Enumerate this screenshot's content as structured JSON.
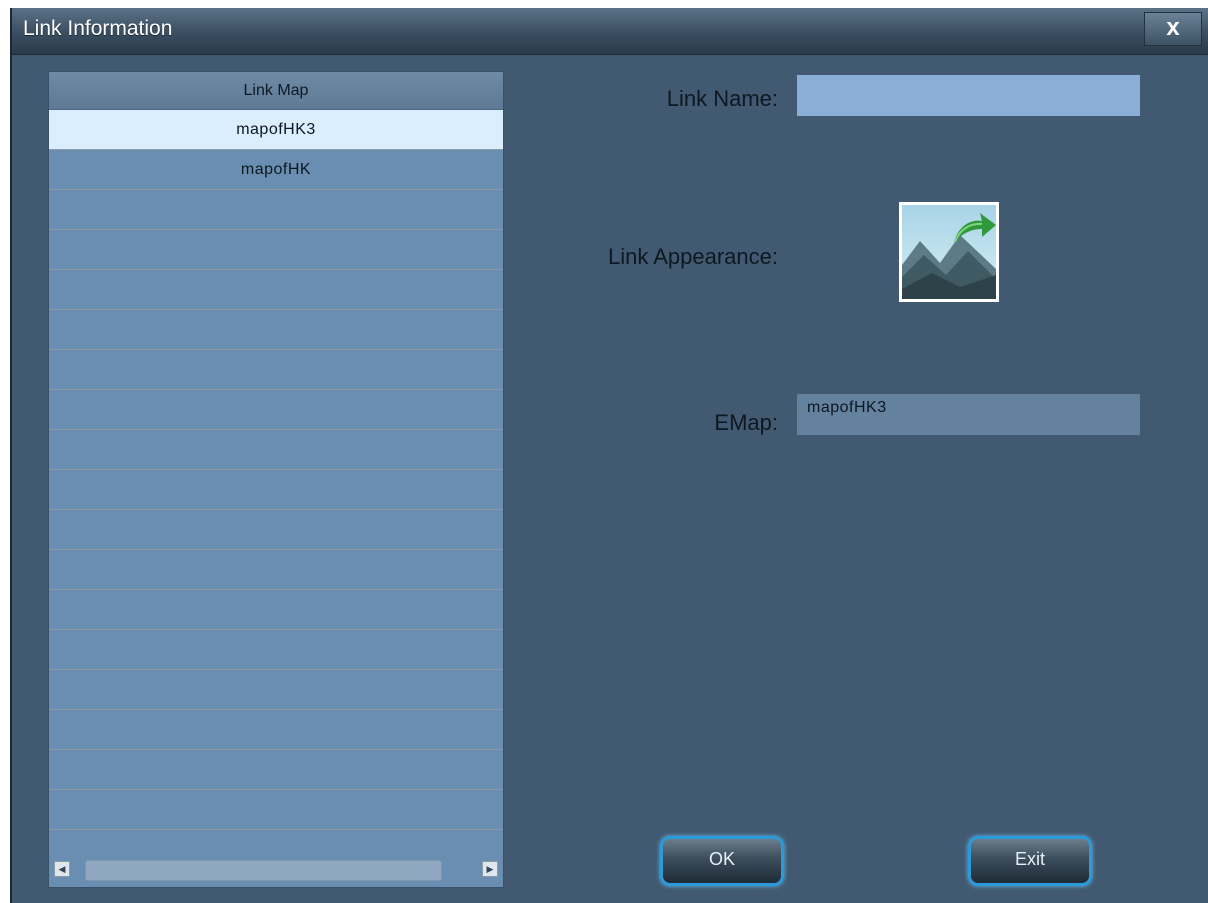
{
  "window": {
    "title": "Link Information",
    "close_label": "x"
  },
  "list": {
    "header": "Link Map",
    "items": [
      {
        "label": "mapofHK3",
        "selected": true
      },
      {
        "label": "mapofHK",
        "selected": false
      },
      {
        "label": "",
        "selected": false
      },
      {
        "label": "",
        "selected": false
      },
      {
        "label": "",
        "selected": false
      },
      {
        "label": "",
        "selected": false
      },
      {
        "label": "",
        "selected": false
      },
      {
        "label": "",
        "selected": false
      },
      {
        "label": "",
        "selected": false
      },
      {
        "label": "",
        "selected": false
      },
      {
        "label": "",
        "selected": false
      },
      {
        "label": "",
        "selected": false
      },
      {
        "label": "",
        "selected": false
      },
      {
        "label": "",
        "selected": false
      },
      {
        "label": "",
        "selected": false
      },
      {
        "label": "",
        "selected": false
      },
      {
        "label": "",
        "selected": false
      },
      {
        "label": "",
        "selected": false
      },
      {
        "label": "",
        "selected": false
      },
      {
        "label": "",
        "selected": false
      }
    ]
  },
  "form": {
    "link_name_label": "Link Name:",
    "link_name_value": "",
    "link_appearance_label": "Link Appearance:",
    "appearance_icon": "map-link-image-icon",
    "emap_label": "EMap:",
    "emap_value": "mapofHK3"
  },
  "buttons": {
    "ok_label": "OK",
    "exit_label": "Exit"
  },
  "colors": {
    "window_bg": "#425a71",
    "list_bg": "#6a8eb2",
    "selected_row": "#dbeefd",
    "button_border": "#2b9ad6",
    "link_name_field": "#8aaed6",
    "emap_field": "#64819d"
  }
}
